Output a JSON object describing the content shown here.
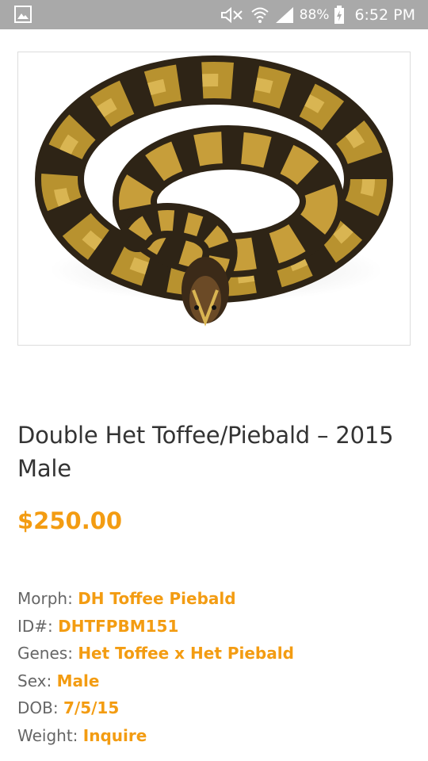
{
  "status_bar": {
    "battery_percent": "88%",
    "time": "6:52 PM",
    "icons": [
      "gallery-icon",
      "mute-icon",
      "wifi-icon",
      "signal-icon",
      "battery-charging-icon"
    ]
  },
  "product": {
    "image_alt": "ball python",
    "title": "Double Het Toffee/Piebald – 2015 Male",
    "price": "$250.00",
    "colors": {
      "accent": "#f39c12",
      "label": "#666666",
      "title": "#333333"
    },
    "specs": [
      {
        "label": "Morph:",
        "value": "DH Toffee Piebald"
      },
      {
        "label": "ID#:",
        "value": "DHTFPBM151"
      },
      {
        "label": "Genes:",
        "value": "Het Toffee x Het Piebald"
      },
      {
        "label": "Sex:",
        "value": "Male"
      },
      {
        "label": "DOB:",
        "value": "7/5/15"
      },
      {
        "label": "Weight:",
        "value": "Inquire"
      }
    ]
  }
}
